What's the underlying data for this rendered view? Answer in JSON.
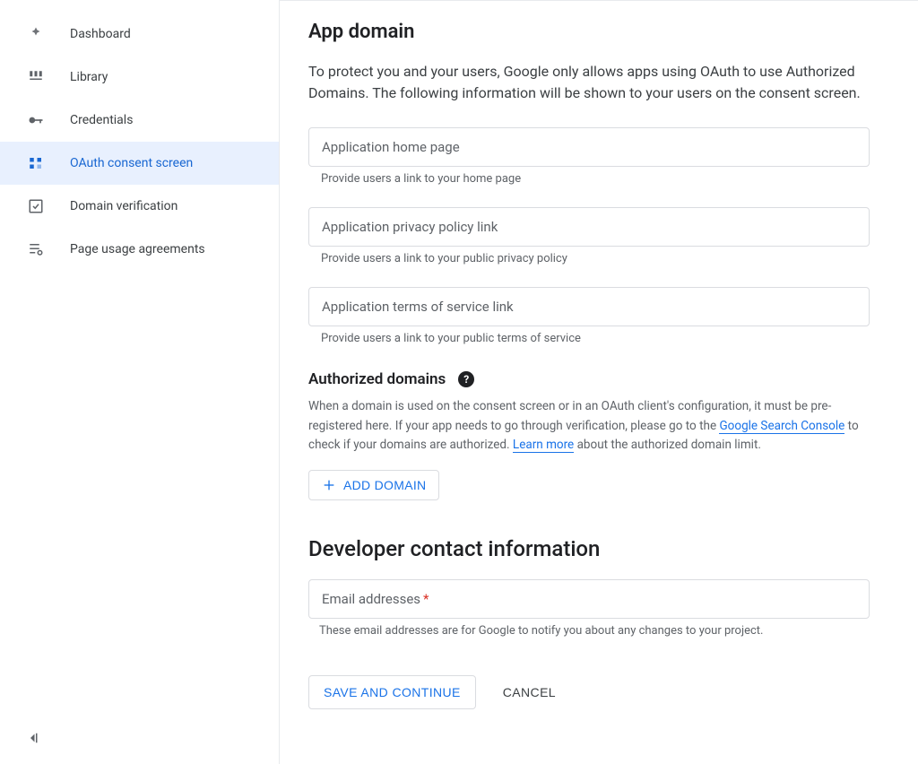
{
  "sidebar": {
    "items": [
      {
        "label": "Dashboard"
      },
      {
        "label": "Library"
      },
      {
        "label": "Credentials"
      },
      {
        "label": "OAuth consent screen"
      },
      {
        "label": "Domain verification"
      },
      {
        "label": "Page usage agreements"
      }
    ]
  },
  "appDomain": {
    "heading": "App domain",
    "description": "To protect you and your users, Google only allows apps using OAuth to use Authorized Domains. The following information will be shown to your users on the consent screen.",
    "homepage": {
      "placeholder": "Application home page",
      "helper": "Provide users a link to your home page"
    },
    "privacy": {
      "placeholder": "Application privacy policy link",
      "helper": "Provide users a link to your public privacy policy"
    },
    "tos": {
      "placeholder": "Application terms of service link",
      "helper": "Provide users a link to your public terms of service"
    }
  },
  "authorizedDomains": {
    "heading": "Authorized domains",
    "text_before": "When a domain is used on the consent screen or in an OAuth client's configuration, it must be pre-registered here. If your app needs to go through verification, please go to the ",
    "link1": "Google Search Console",
    "text_mid": " to check if your domains are authorized. ",
    "link2": "Learn more",
    "text_after": " about the authorized domain limit.",
    "addButton": "ADD DOMAIN"
  },
  "developerContact": {
    "heading": "Developer contact information",
    "emailLabel": "Email addresses",
    "helper": "These email addresses are for Google to notify you about any changes to your project."
  },
  "actions": {
    "save": "SAVE AND CONTINUE",
    "cancel": "CANCEL"
  }
}
